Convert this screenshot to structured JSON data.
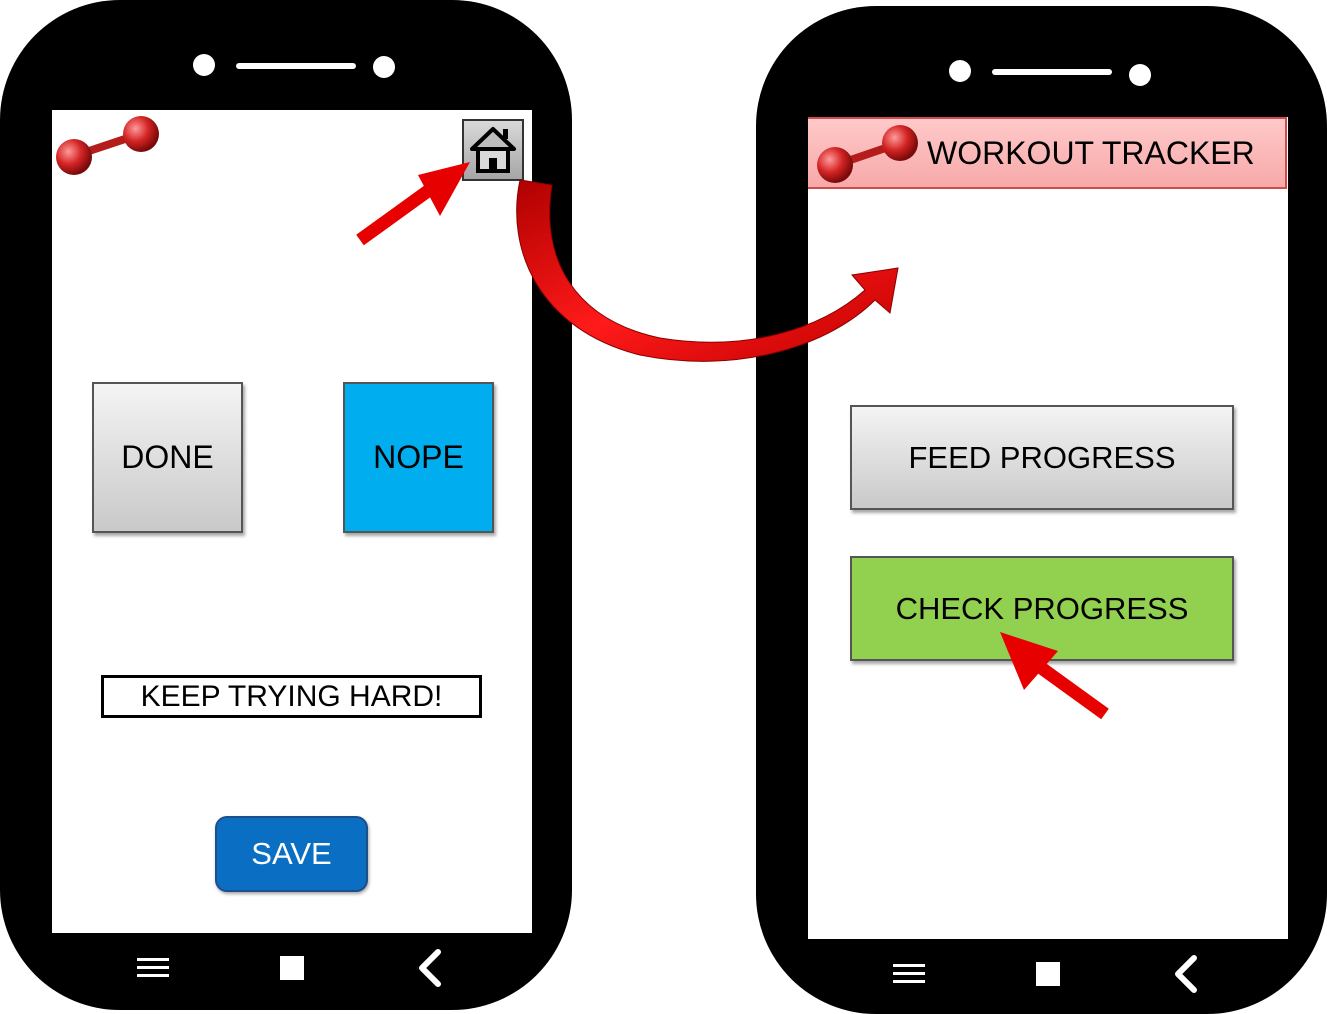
{
  "left_screen": {
    "done_label": "DONE",
    "nope_label": "NOPE",
    "message": "KEEP TRYING HARD!",
    "save_label": "SAVE",
    "icons": {
      "logo": "dumbbell-icon",
      "home": "home-icon"
    }
  },
  "right_screen": {
    "title": "WORKOUT TRACKER",
    "feed_label": "FEED PROGRESS",
    "check_label": "CHECK PROGRESS",
    "icons": {
      "logo": "dumbbell-icon"
    }
  },
  "nav_bar": {
    "icons": [
      "menu-icon",
      "square-icon",
      "back-icon"
    ]
  },
  "colors": {
    "nope": "#00aeef",
    "check": "#92d050",
    "save": "#0a6fc2",
    "title_bar": "#f7a9a9",
    "arrow": "#e60000"
  }
}
